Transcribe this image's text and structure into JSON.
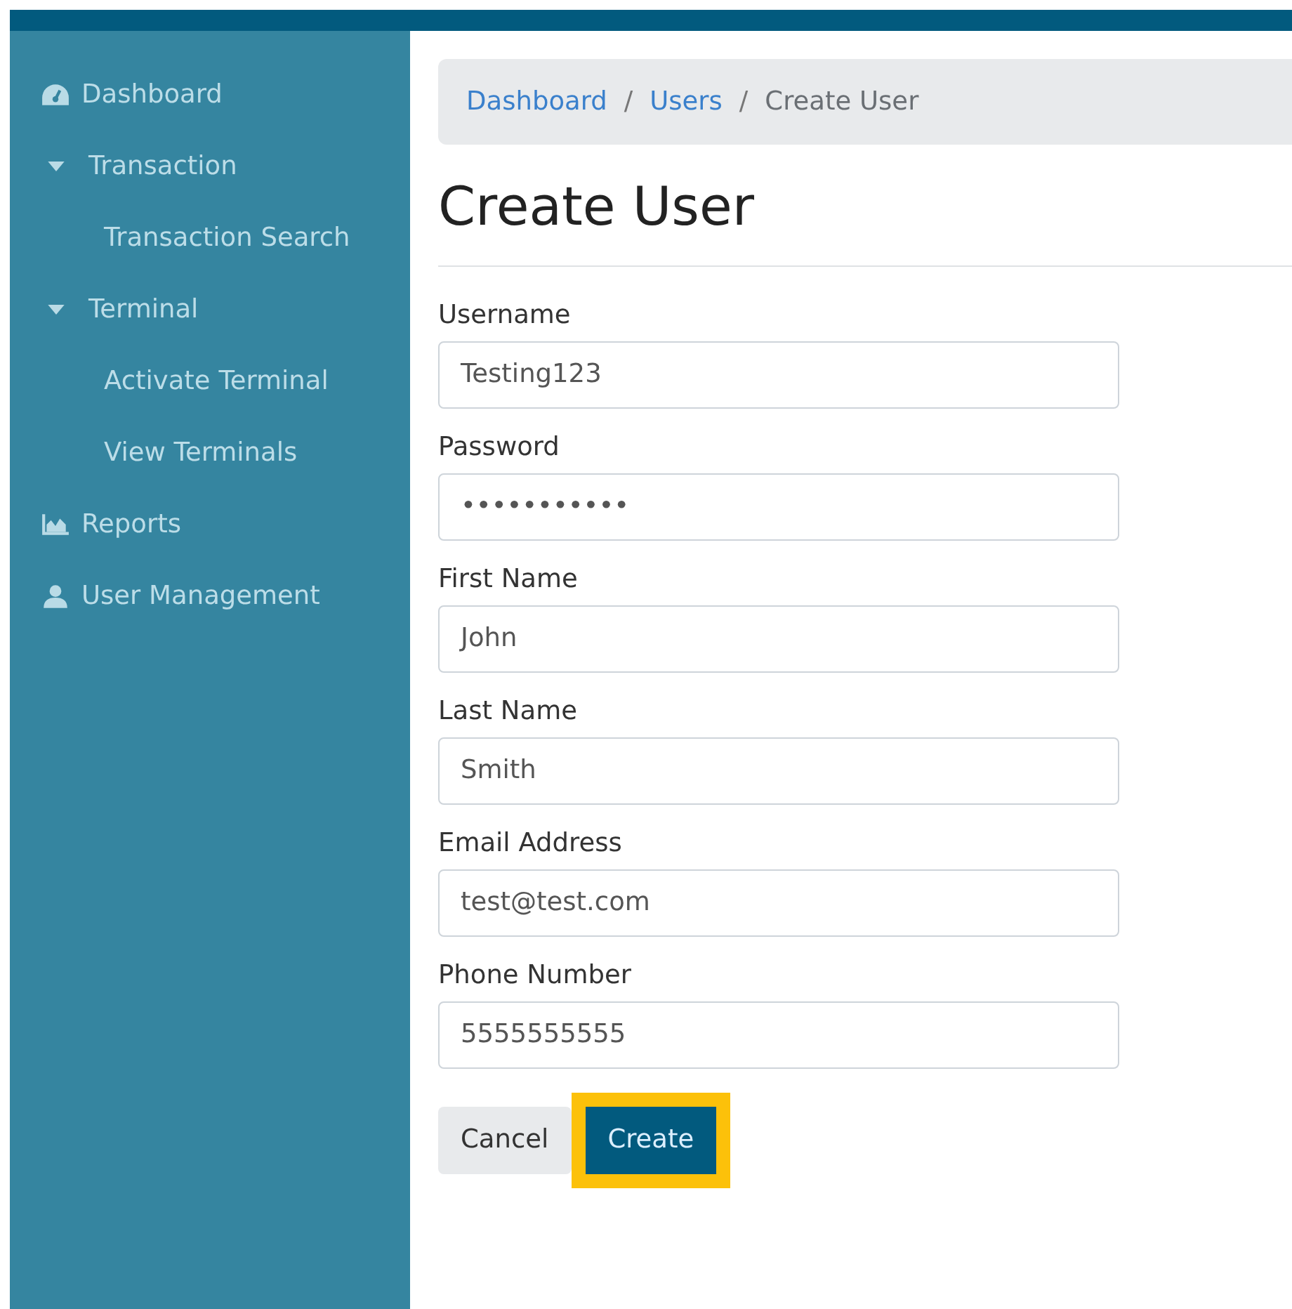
{
  "sidebar": {
    "items": [
      {
        "label": "Dashboard",
        "kind": "dashboard"
      },
      {
        "label": "Transaction",
        "kind": "group",
        "expanded": true,
        "children": [
          {
            "label": "Transaction Search"
          }
        ]
      },
      {
        "label": "Terminal",
        "kind": "group",
        "expanded": true,
        "children": [
          {
            "label": "Activate Terminal"
          },
          {
            "label": "View Terminals"
          }
        ]
      },
      {
        "label": "Reports",
        "kind": "reports"
      },
      {
        "label": "User Management",
        "kind": "users"
      }
    ]
  },
  "breadcrumb": [
    {
      "label": "Dashboard",
      "kind": "link"
    },
    {
      "separator": "/",
      "label": "Users",
      "kind": "link"
    },
    {
      "separator": "/",
      "label": "Create User",
      "kind": "current"
    }
  ],
  "heading": "Create User",
  "fields": [
    {
      "label": "Username",
      "value": "Testing123"
    },
    {
      "label": "Password",
      "value": "•••••••••••"
    },
    {
      "label": "First Name",
      "value": "John"
    },
    {
      "label": "Last Name",
      "value": "Smith"
    },
    {
      "label": "Email Address",
      "value": "test@test.com"
    },
    {
      "label": "Phone Number",
      "value": "5555555555"
    }
  ],
  "buttons": [
    {
      "label": "Cancel",
      "kind": "secondary",
      "highlighted": false
    },
    {
      "label": "Create",
      "kind": "primary",
      "highlighted": true
    }
  ]
}
